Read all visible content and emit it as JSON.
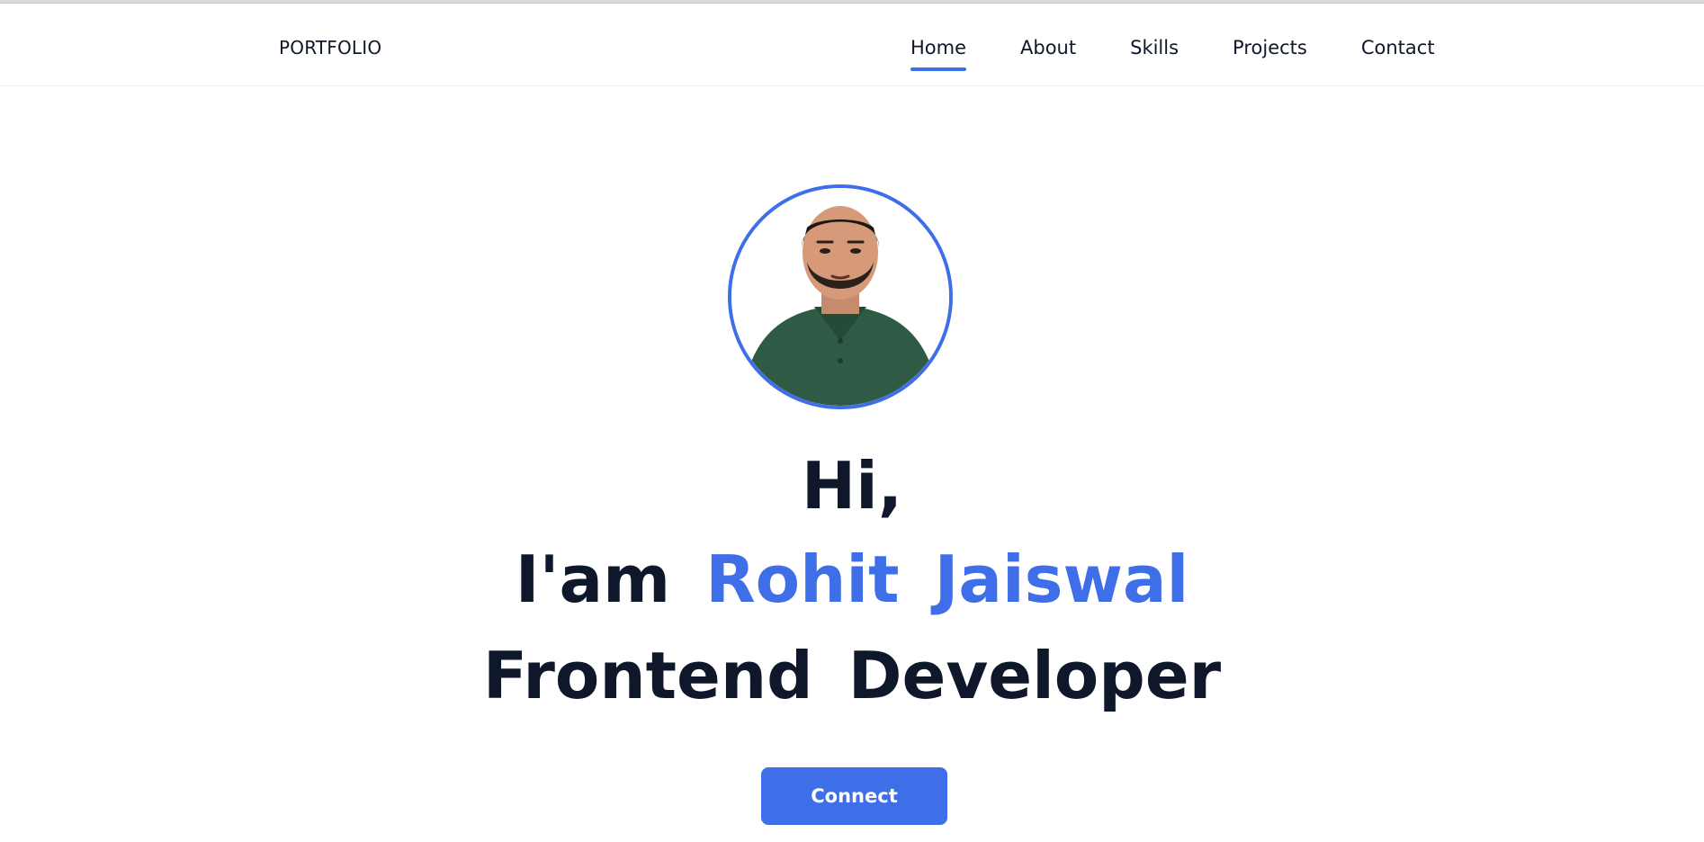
{
  "header": {
    "brand": "PORTFOLIO",
    "nav": [
      {
        "label": "Home",
        "active": true
      },
      {
        "label": "About",
        "active": false
      },
      {
        "label": "Skills",
        "active": false
      },
      {
        "label": "Projects",
        "active": false
      },
      {
        "label": "Contact",
        "active": false
      }
    ]
  },
  "hero": {
    "greeting": "Hi,",
    "intro": "I'am",
    "first_name": "Rohit",
    "last_name": "Jaiswal",
    "role_word_1": "Frontend",
    "role_word_2": "Developer",
    "cta_label": "Connect"
  },
  "theme": {
    "accent": "#3f6fe8",
    "text": "#0f172a",
    "shirt": "#2f5a45"
  }
}
